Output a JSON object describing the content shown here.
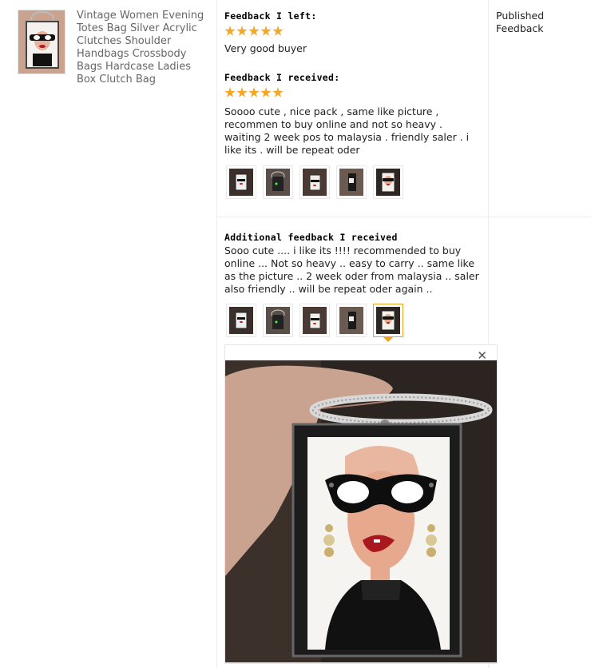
{
  "product": {
    "title": "Vintage Women Evening Totes Bag Silver Acrylic Clutches Shoulder Handbags Crossbody Bags Hardcase Ladies Box Clutch Bag"
  },
  "feedback_left": {
    "heading": "Feedback I left:",
    "rating": 5,
    "text": "Very good buyer"
  },
  "feedback_received": {
    "heading": "Feedback I received:",
    "rating": 5,
    "text": "Soooo cute , nice pack , same like picture , recommen to buy online and not so heavy . waiting 2 week pos to malaysia . friendly saler . i like its . will be repeat oder",
    "photos": [
      "photo-1",
      "photo-2",
      "photo-3",
      "photo-4",
      "photo-5"
    ]
  },
  "additional_feedback": {
    "heading": "Additional feedback I received",
    "text": "Sooo cute .... i like its !!!! recommended to buy online ... Not so heavy .. easy to carry .. same like as the picture .. 2 week oder from malaysia .. saler also friendly .. will be repeat oder again ..",
    "photos": [
      "photo-1",
      "photo-2",
      "photo-3",
      "photo-4",
      "photo-5"
    ],
    "selected_photo_index": 4
  },
  "status": {
    "label": "Published Feedback"
  },
  "viewer": {
    "close_icon": "close-icon"
  },
  "colors": {
    "star": "#f5a623",
    "selected_border": "#f0a020",
    "divider": "#ececec"
  }
}
